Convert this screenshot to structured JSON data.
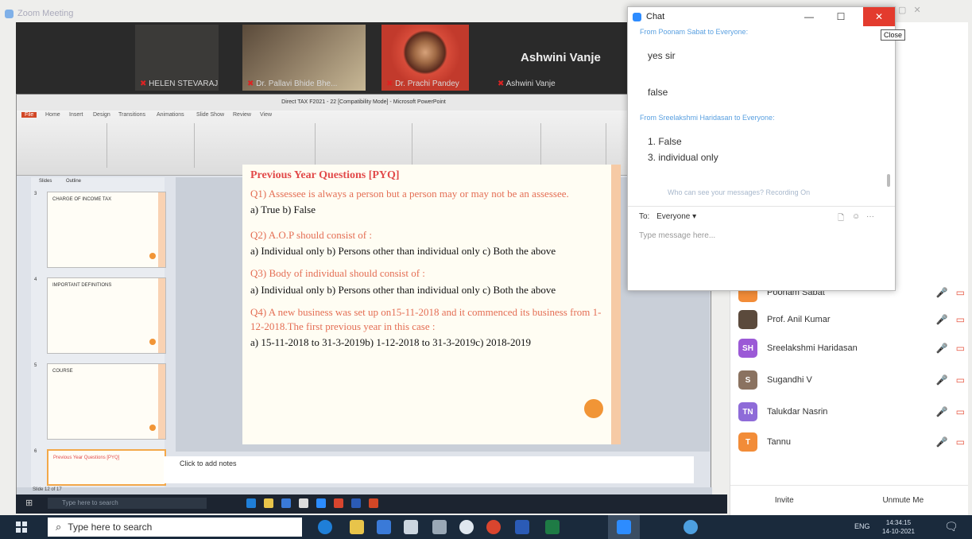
{
  "zoom": {
    "window_title": "Zoom Meeting",
    "video_tiles": [
      {
        "name": "HELEN STEVARAJ"
      },
      {
        "name": "Dr. Pallavi Bhide Bhe..."
      },
      {
        "name": "Dr. Prachi Pandey"
      },
      {
        "name": "Ashwini Vanje"
      }
    ],
    "active_speaker": "Ashwini Vanje"
  },
  "powerpoint": {
    "title": "Direct TAX F2021 - 22 [Compatibility Mode] - Microsoft PowerPoint",
    "tabs": [
      "File",
      "Home",
      "Insert",
      "Design",
      "Transitions",
      "Animations",
      "Slide Show",
      "Review",
      "View"
    ],
    "panel_tabs": [
      "Slides",
      "Outline"
    ],
    "slide_numbers": [
      "3",
      "4",
      "5",
      "6"
    ],
    "thumbs": [
      {
        "title": "CHARGE OF INCOME TAX"
      },
      {
        "title": "IMPORTANT DEFINITIONS"
      },
      {
        "title": "COURSE"
      },
      {
        "title": "Previous Year Questions [PYQ]"
      }
    ],
    "slide": {
      "title": "Previous Year Questions [PYQ]",
      "q1": "Q1) Assessee is always a person but a person may or may not be an assessee.",
      "a1": "a) True b) False",
      "q2": "Q2) A.O.P should consist of :",
      "a2": "a) Individual only b) Persons other than individual only c) Both the above",
      "q3": "Q3) Body of individual should consist of :",
      "a3": "a) Individual only b) Persons other than individual only c) Both the above",
      "q4": "Q4) A new business was set up on15-11-2018 and it commenced its business from 1-12-2018.The first previous year in this case :",
      "a4": "a) 15-11-2018 to 31-3-2019b) 1-12-2018 to 31-3-2019c) 2018-2019"
    },
    "notes_placeholder": "Click to add notes",
    "status": "Slide 12 of 17"
  },
  "inner_taskbar": {
    "search_placeholder": "Type here to search"
  },
  "chat": {
    "title": "Chat",
    "close_tooltip": "Close",
    "from1": "From Poonam Sabat to Everyone:",
    "msg1": "yes sir",
    "msg2": "false",
    "from2": "From Sreelakshmi Haridasan to Everyone:",
    "msg3_line1": "1. False",
    "msg3_line2": "3. individual only",
    "who_can_see": "Who can see your messages? Recording On",
    "to_label": "To:",
    "to_value": "Everyone ▾",
    "input_placeholder": "Type message here..."
  },
  "participants": [
    {
      "name": "Poonam Sabat",
      "initials": "",
      "color": "#f28c38"
    },
    {
      "name": "Prof. Anil Kumar",
      "initials": "",
      "color": "#5b4a3c"
    },
    {
      "name": "Sreelakshmi Haridasan",
      "initials": "SH",
      "color": "#9b59d6"
    },
    {
      "name": "Sugandhi V",
      "initials": "S",
      "color": "#8a7260"
    },
    {
      "name": "Talukdar Nasrin",
      "initials": "TN",
      "color": "#8e6bd8"
    },
    {
      "name": "Tannu",
      "initials": "T",
      "color": "#f28c38"
    }
  ],
  "participants_footer": {
    "invite": "Invite",
    "unmute": "Unmute Me"
  },
  "taskbar": {
    "search_placeholder": "Type here to search",
    "time": "14:34:15",
    "date": "14-10-2021",
    "lang": "ENG"
  },
  "colors": {
    "zoom_red": "#e33b2e",
    "zoom_blue": "#2d8cff",
    "slide_red": "#e24a4a"
  }
}
